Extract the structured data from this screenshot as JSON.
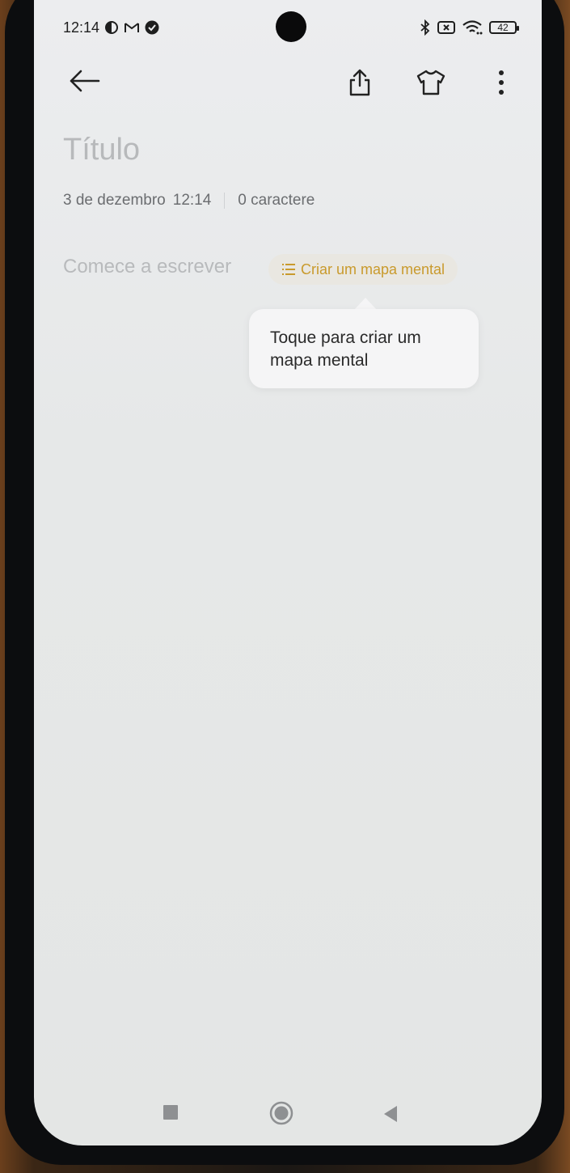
{
  "status_bar": {
    "time": "12:14",
    "battery_level": "42",
    "left_icons": [
      "data-saver-icon",
      "gmail-icon",
      "check-circle-icon"
    ],
    "right_icons": [
      "bluetooth-icon",
      "no-sim-icon",
      "wifi-icon",
      "battery-icon"
    ]
  },
  "toolbar": {
    "icons": [
      "back-arrow-icon",
      "share-icon",
      "theme-shirt-icon",
      "more-vert-icon"
    ]
  },
  "note": {
    "title_placeholder": "Título",
    "date": "3 de dezembro",
    "time": "12:14",
    "char_count": "0 caractere",
    "body_placeholder": "Comece a escrever"
  },
  "mindmap": {
    "button_label": "Criar um mapa mental",
    "tooltip": "Toque para criar um mapa mental"
  },
  "nav_bar": {
    "icons": [
      "recents-square-icon",
      "home-circle-icon",
      "back-triangle-icon"
    ]
  },
  "colors": {
    "accent": "#c99a2c",
    "background": "#e8e9ea",
    "placeholder": "#b8babc"
  }
}
